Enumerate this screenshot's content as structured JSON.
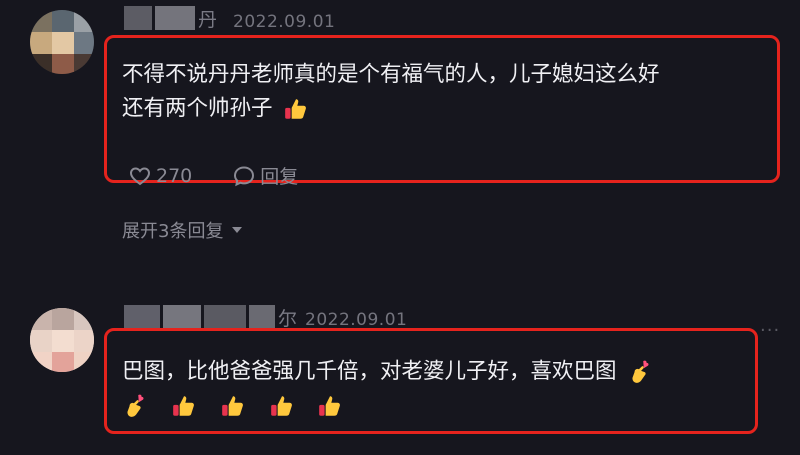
{
  "comments": [
    {
      "username_suffix": "丹",
      "date": "2022.09.01",
      "text_line1": "不得不说丹丹老师真的是个有福气的人，儿子媳妇这么好",
      "text_line2": "还有两个帅孙子",
      "like_count": "270",
      "reply_label": "回复",
      "expand_label": "展开3条回复"
    },
    {
      "username_suffix": "尔",
      "date": "2022.09.01",
      "text_line1": "巴图，比他爸爸强几千倍，对老婆儿子好，喜欢巴图",
      "emoji_line2": [
        "finger-heart",
        "thumbs-up",
        "thumbs-up",
        "thumbs-up",
        "thumbs-up"
      ]
    }
  ],
  "colors": {
    "background": "#16161e",
    "highlight": "#e5231d",
    "muted_text": "#8a8a94"
  }
}
